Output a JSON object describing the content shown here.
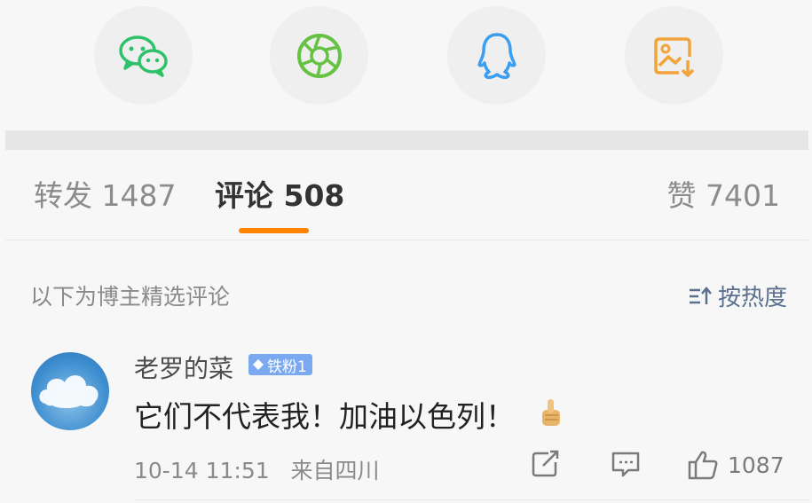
{
  "share": {
    "items": [
      {
        "icon": "wechat-icon",
        "color": "#2dc26a"
      },
      {
        "icon": "moments-icon",
        "color": "#65c242"
      },
      {
        "icon": "qq-icon",
        "color": "#3b9ef0"
      },
      {
        "icon": "save-image-icon",
        "color": "#f2a33a"
      }
    ]
  },
  "tabs": {
    "repost": "转发 1487",
    "comment": "评论 508",
    "like": "赞 7401"
  },
  "comments": {
    "notice": "以下为博主精选评论",
    "sort_label": "按热度",
    "item": {
      "username": "老罗的菜",
      "badge": "铁粉1",
      "text": "它们不代表我！加油以色列！",
      "emoji": "thumbs-up-emoji",
      "time": "10-14 11:51",
      "source": "来自四川",
      "like_count": "1087"
    }
  },
  "colors": {
    "accent": "#ff8200",
    "badge": "#7aa9f0",
    "link": "#5b6f8f"
  }
}
